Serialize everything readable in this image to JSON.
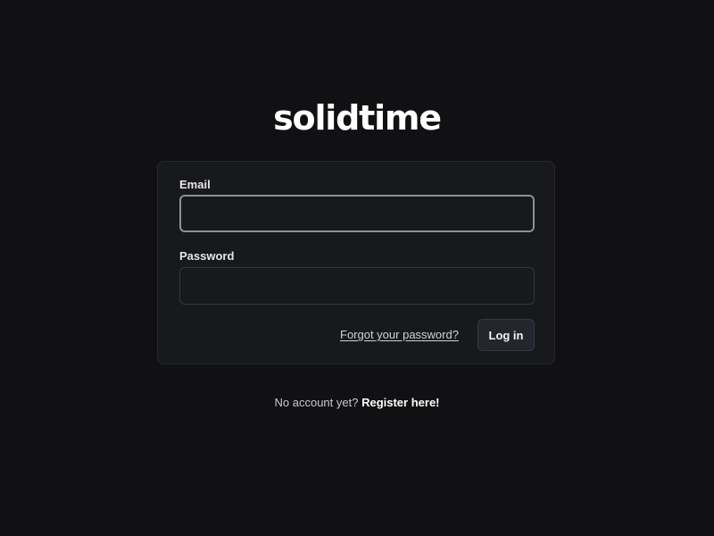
{
  "brand": {
    "logo_text": "solidtime"
  },
  "login_form": {
    "email": {
      "label": "Email",
      "value": "",
      "placeholder": ""
    },
    "password": {
      "label": "Password",
      "value": "",
      "placeholder": ""
    },
    "forgot_password_link": "Forgot your password?",
    "login_button": "Log in"
  },
  "footer": {
    "register_prompt": "No account yet?",
    "register_link": "Register here!"
  },
  "colors": {
    "background": "#111113",
    "card_background": "#18191c",
    "focused_border": "#8e9096",
    "button_background": "#23272d"
  }
}
